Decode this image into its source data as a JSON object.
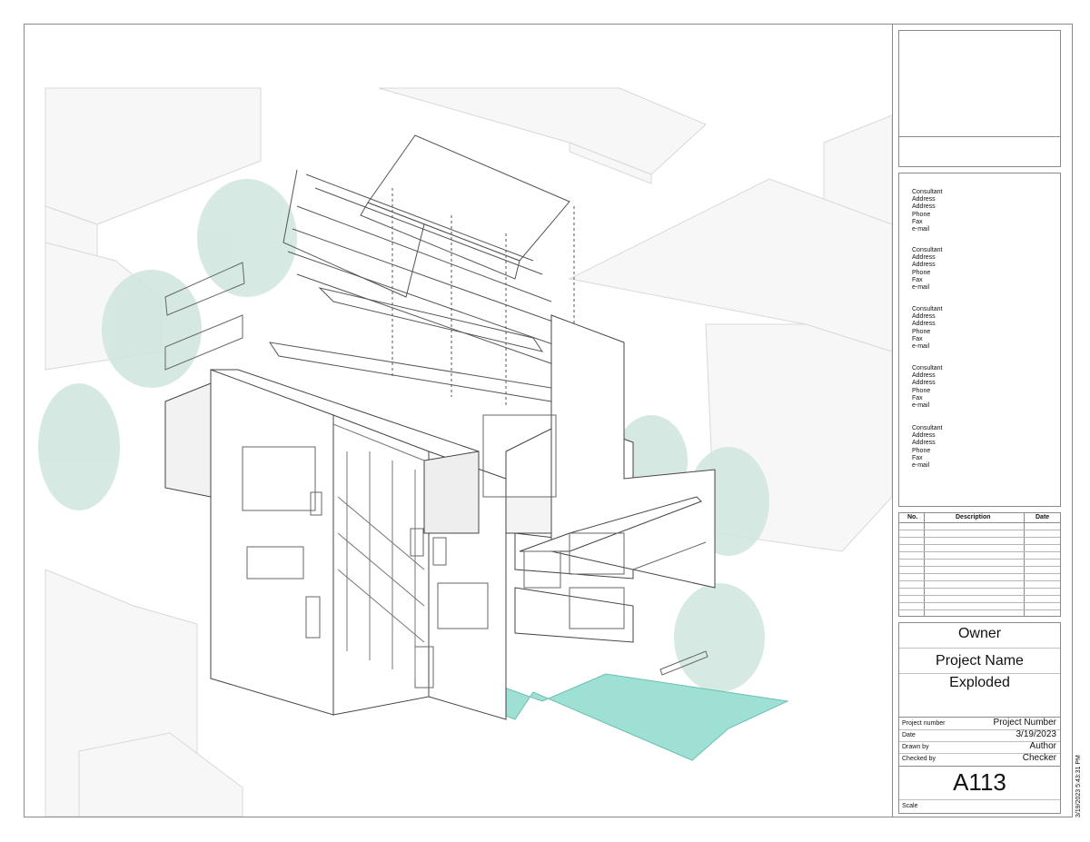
{
  "consultants": [
    {
      "lines": [
        "Consultant",
        "Address",
        "Address",
        "Phone",
        "Fax",
        "e-mail"
      ]
    },
    {
      "lines": [
        "Consultant",
        "Address",
        "Address",
        "Phone",
        "Fax",
        "e-mail"
      ]
    },
    {
      "lines": [
        "Consultant",
        "Address",
        "Address",
        "Phone",
        "Fax",
        "e-mail"
      ]
    },
    {
      "lines": [
        "Consultant",
        "Address",
        "Address",
        "Phone",
        "Fax",
        "e-mail"
      ]
    },
    {
      "lines": [
        "Consultant",
        "Address",
        "Address",
        "Phone",
        "Fax",
        "e-mail"
      ]
    }
  ],
  "revisions": {
    "col_no": "No.",
    "col_description": "Description",
    "col_date": "Date"
  },
  "title_block": {
    "owner": "Owner",
    "project_name": "Project Name",
    "sheet_name": "Exploded",
    "project_number_label": "Project number",
    "project_number_value": "Project Number",
    "date_label": "Date",
    "date_value": "3/19/2023",
    "drawn_by_label": "Drawn by",
    "drawn_by_value": "Author",
    "checked_by_label": "Checked by",
    "checked_by_value": "Checker",
    "sheet_number": "A113",
    "scale_label": "Scale"
  },
  "print_stamp": "3/19/2023 5:43:31 PM",
  "colors": {
    "pool": "#9ee0d4",
    "tree": "#cfe5dd",
    "line": "#555555",
    "context": "#dcdcdc"
  }
}
